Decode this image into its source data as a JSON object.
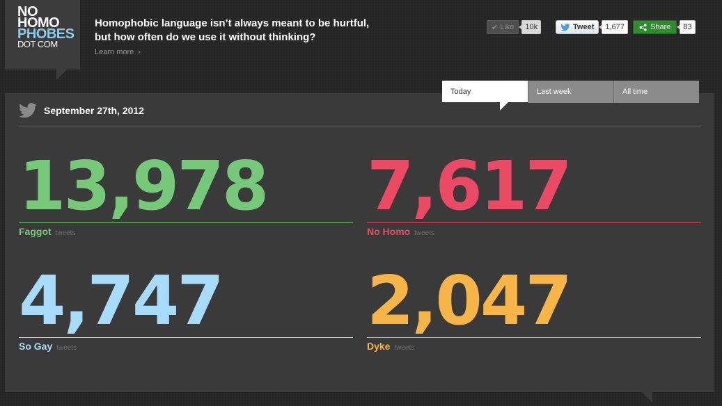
{
  "logo": {
    "line1": "NO",
    "line2": "HOMO",
    "line3": "PHOBES",
    "line4": "DOT COM"
  },
  "header": {
    "tagline_line1": "Homophobic language isn’t always meant to be hurtful,",
    "tagline_line2": "but how often do we use it without thinking?",
    "learn_more": "Learn more"
  },
  "social": {
    "like_label": "Like",
    "like_count": "10k",
    "tweet_label": "Tweet",
    "tweet_count": "1,677",
    "share_label": "Share",
    "share_count": "83"
  },
  "tabs": [
    {
      "label": "Today"
    },
    {
      "label": "Last week"
    },
    {
      "label": "All time"
    }
  ],
  "panel": {
    "date": "September 27th, 2012"
  },
  "stats": [
    {
      "count": "13,978",
      "term": "Faggot",
      "unit": "tweets",
      "color": "#75c979"
    },
    {
      "count": "7,617",
      "term": "No Homo",
      "unit": "tweets",
      "color": "#ec4a64"
    },
    {
      "count": "4,747",
      "term": "So Gay",
      "unit": "tweets",
      "color": "#a6dcf9"
    },
    {
      "count": "2,047",
      "term": "Dyke",
      "unit": "tweets",
      "color": "#f8b547"
    }
  ]
}
